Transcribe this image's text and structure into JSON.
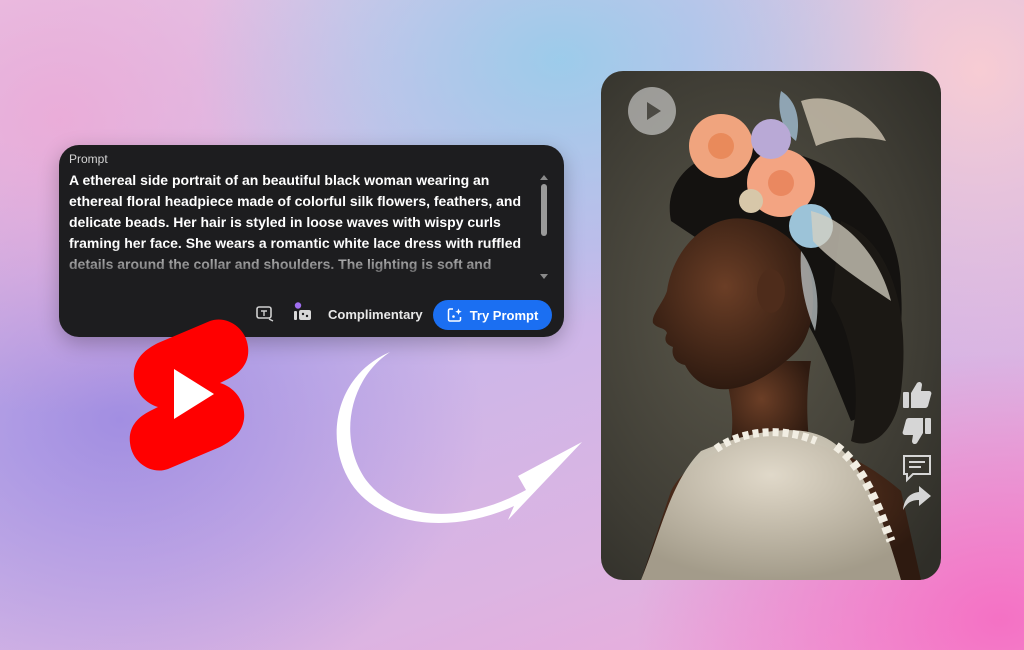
{
  "prompt_card": {
    "label": "Prompt",
    "text": "A ethereal side portrait of an beautiful black woman wearing an ethereal floral headpiece made of colorful silk flowers, feathers, and delicate beads. Her hair is styled in loose waves with wispy curls framing her face. She wears a romantic white lace dress with ruffled details around the collar and shoulders. The lighting is soft and diffused, creating a gentle glow on",
    "credit_label": "Complimentary",
    "try_button_label": "Try Prompt"
  },
  "icons": {
    "aspect_ratio": "aspect-ratio-icon",
    "style_reference": "style-reference-icon",
    "try_prompt": "sparkle-frame-icon",
    "logo": "youtube-shorts-logo",
    "arrow": "curved-arrow",
    "play": "play-icon",
    "like": "thumbs-up-icon",
    "dislike": "thumbs-down-icon",
    "comment": "comment-icon",
    "share": "share-icon"
  },
  "colors": {
    "card_bg": "#1d1d1f",
    "button_blue": "#1b6ff2",
    "shorts_red": "#ff0000"
  }
}
